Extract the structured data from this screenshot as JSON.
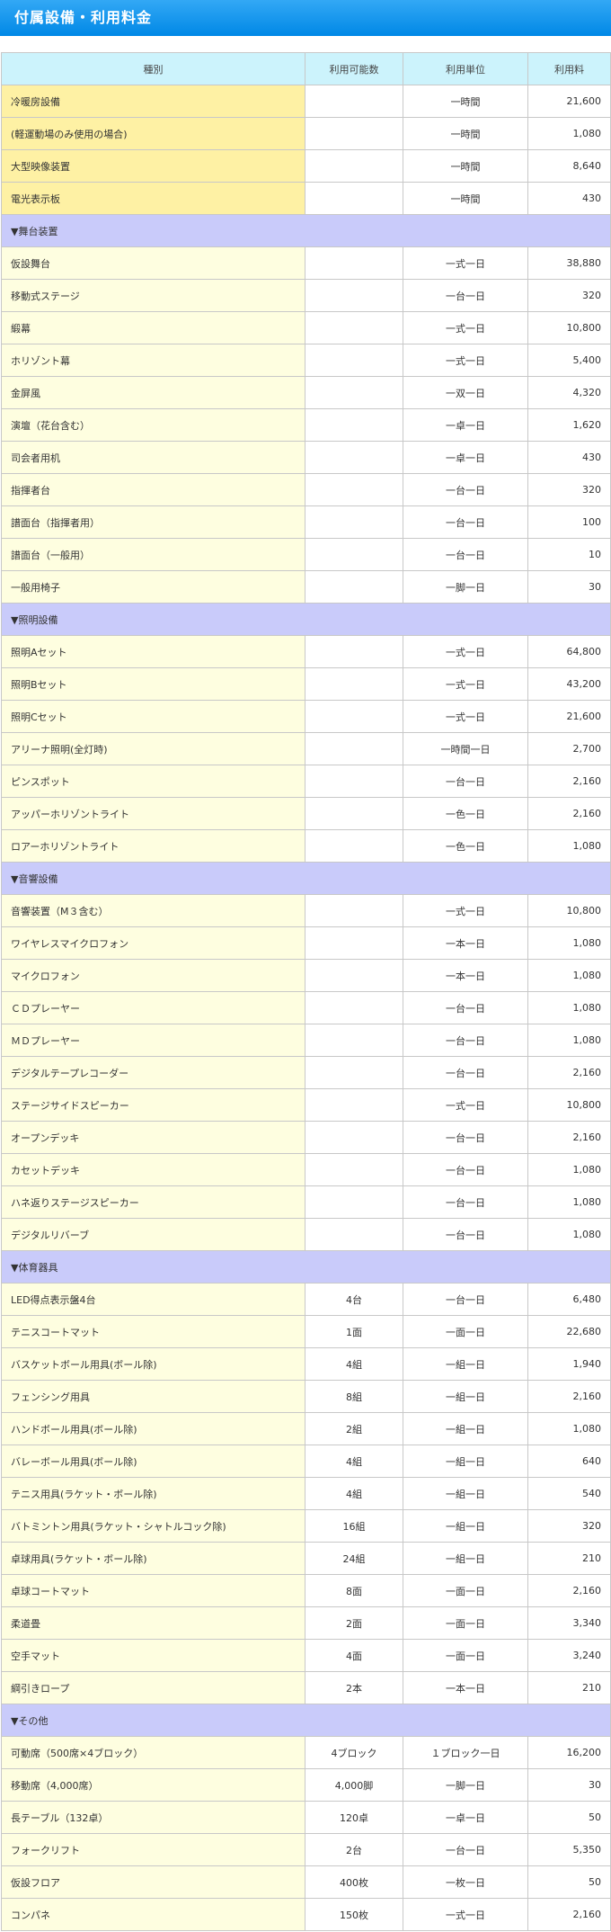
{
  "page": {
    "title": "付属設備・利用料金"
  },
  "table": {
    "headers": {
      "type": "種別",
      "count": "利用可能数",
      "unit": "利用単位",
      "fee": "利用料"
    },
    "rows": [
      {
        "kind": "item",
        "highlight": true,
        "name": "冷暖房設備",
        "count": "",
        "unit": "一時間",
        "fee": "21,600"
      },
      {
        "kind": "item",
        "highlight": true,
        "name": "(軽運動場のみ使用の場合)",
        "count": "",
        "unit": "一時間",
        "fee": "1,080"
      },
      {
        "kind": "item",
        "highlight": true,
        "name": "大型映像装置",
        "count": "",
        "unit": "一時間",
        "fee": "8,640"
      },
      {
        "kind": "item",
        "highlight": true,
        "name": "電光表示板",
        "count": "",
        "unit": "一時間",
        "fee": "430"
      },
      {
        "kind": "section",
        "name": "▼舞台装置"
      },
      {
        "kind": "item",
        "name": "仮設舞台",
        "count": "",
        "unit": "一式一日",
        "fee": "38,880"
      },
      {
        "kind": "item",
        "name": "移動式ステージ",
        "count": "",
        "unit": "一台一日",
        "fee": "320"
      },
      {
        "kind": "item",
        "name": "緞幕",
        "count": "",
        "unit": "一式一日",
        "fee": "10,800"
      },
      {
        "kind": "item",
        "name": "ホリゾント幕",
        "count": "",
        "unit": "一式一日",
        "fee": "5,400"
      },
      {
        "kind": "item",
        "name": "金屏風",
        "count": "",
        "unit": "一双一日",
        "fee": "4,320"
      },
      {
        "kind": "item",
        "name": "演壇（花台含む）",
        "count": "",
        "unit": "一卓一日",
        "fee": "1,620"
      },
      {
        "kind": "item",
        "name": "司会者用机",
        "count": "",
        "unit": "一卓一日",
        "fee": "430"
      },
      {
        "kind": "item",
        "name": "指揮者台",
        "count": "",
        "unit": "一台一日",
        "fee": "320"
      },
      {
        "kind": "item",
        "name": "譜面台（指揮者用）",
        "count": "",
        "unit": "一台一日",
        "fee": "100"
      },
      {
        "kind": "item",
        "name": "譜面台（一般用）",
        "count": "",
        "unit": "一台一日",
        "fee": "10"
      },
      {
        "kind": "item",
        "name": "一般用椅子",
        "count": "",
        "unit": "一脚一日",
        "fee": "30"
      },
      {
        "kind": "section",
        "name": "▼照明設備"
      },
      {
        "kind": "item",
        "name": "照明Aセット",
        "count": "",
        "unit": "一式一日",
        "fee": "64,800"
      },
      {
        "kind": "item",
        "name": "照明Bセット",
        "count": "",
        "unit": "一式一日",
        "fee": "43,200"
      },
      {
        "kind": "item",
        "name": "照明Cセット",
        "count": "",
        "unit": "一式一日",
        "fee": "21,600"
      },
      {
        "kind": "item",
        "name": "アリーナ照明(全灯時)",
        "count": "",
        "unit": "一時間一日",
        "fee": "2,700"
      },
      {
        "kind": "item",
        "name": "ピンスポット",
        "count": "",
        "unit": "一台一日",
        "fee": "2,160"
      },
      {
        "kind": "item",
        "name": "アッパーホリゾントライト",
        "count": "",
        "unit": "一色一日",
        "fee": "2,160"
      },
      {
        "kind": "item",
        "name": "ロアーホリゾントライト",
        "count": "",
        "unit": "一色一日",
        "fee": "1,080"
      },
      {
        "kind": "section",
        "name": "▼音響設備"
      },
      {
        "kind": "item",
        "name": "音響装置（M３含む）",
        "count": "",
        "unit": "一式一日",
        "fee": "10,800"
      },
      {
        "kind": "item",
        "name": "ワイヤレスマイクロフォン",
        "count": "",
        "unit": "一本一日",
        "fee": "1,080"
      },
      {
        "kind": "item",
        "name": "マイクロフォン",
        "count": "",
        "unit": "一本一日",
        "fee": "1,080"
      },
      {
        "kind": "item",
        "name": "ＣＤプレーヤー",
        "count": "",
        "unit": "一台一日",
        "fee": "1,080"
      },
      {
        "kind": "item",
        "name": "ＭＤプレーヤー",
        "count": "",
        "unit": "一台一日",
        "fee": "1,080"
      },
      {
        "kind": "item",
        "name": "デジタルテープレコーダー",
        "count": "",
        "unit": "一台一日",
        "fee": "2,160"
      },
      {
        "kind": "item",
        "name": "ステージサイドスピーカー",
        "count": "",
        "unit": "一式一日",
        "fee": "10,800"
      },
      {
        "kind": "item",
        "name": "オープンデッキ",
        "count": "",
        "unit": "一台一日",
        "fee": "2,160"
      },
      {
        "kind": "item",
        "name": "カセットデッキ",
        "count": "",
        "unit": "一台一日",
        "fee": "1,080"
      },
      {
        "kind": "item",
        "name": "ハネ返りステージスピーカー",
        "count": "",
        "unit": "一台一日",
        "fee": "1,080"
      },
      {
        "kind": "item",
        "name": "デジタルリバーブ",
        "count": "",
        "unit": "一台一日",
        "fee": "1,080"
      },
      {
        "kind": "section",
        "name": "▼体育器具"
      },
      {
        "kind": "item",
        "name": "LED得点表示盤4台",
        "count": "4台",
        "unit": "一台一日",
        "fee": "6,480"
      },
      {
        "kind": "item",
        "name": "テニスコートマット",
        "count": "1面",
        "unit": "一面一日",
        "fee": "22,680"
      },
      {
        "kind": "item",
        "name": "バスケットボール用具(ボール除)",
        "count": "4組",
        "unit": "一組一日",
        "fee": "1,940"
      },
      {
        "kind": "item",
        "name": "フェンシング用具",
        "count": "8組",
        "unit": "一組一日",
        "fee": "2,160"
      },
      {
        "kind": "item",
        "name": "ハンドボール用具(ボール除)",
        "count": "2組",
        "unit": "一組一日",
        "fee": "1,080"
      },
      {
        "kind": "item",
        "name": "バレーボール用具(ボール除)",
        "count": "4組",
        "unit": "一組一日",
        "fee": "640"
      },
      {
        "kind": "item",
        "name": "テニス用具(ラケット・ボール除)",
        "count": "4組",
        "unit": "一組一日",
        "fee": "540"
      },
      {
        "kind": "item",
        "name": "バトミントン用具(ラケット・シャトルコック除)",
        "count": "16組",
        "unit": "一組一日",
        "fee": "320"
      },
      {
        "kind": "item",
        "name": "卓球用具(ラケット・ボール除)",
        "count": "24組",
        "unit": "一組一日",
        "fee": "210"
      },
      {
        "kind": "item",
        "name": "卓球コートマット",
        "count": "8面",
        "unit": "一面一日",
        "fee": "2,160"
      },
      {
        "kind": "item",
        "name": "柔道畳",
        "count": "2面",
        "unit": "一面一日",
        "fee": "3,340"
      },
      {
        "kind": "item",
        "name": "空手マット",
        "count": "4面",
        "unit": "一面一日",
        "fee": "3,240"
      },
      {
        "kind": "item",
        "name": "綱引きロープ",
        "count": "2本",
        "unit": "一本一日",
        "fee": "210"
      },
      {
        "kind": "section",
        "name": "▼その他"
      },
      {
        "kind": "item",
        "name": "可動席（500席×4ブロック）",
        "count": "4ブロック",
        "unit": "１ブロック一日",
        "fee": "16,200"
      },
      {
        "kind": "item",
        "name": "移動席（4,000席）",
        "count": "4,000脚",
        "unit": "一脚一日",
        "fee": "30"
      },
      {
        "kind": "item",
        "name": "長テーブル（132卓）",
        "count": "120卓",
        "unit": "一卓一日",
        "fee": "50"
      },
      {
        "kind": "item",
        "name": "フォークリフト",
        "count": "2台",
        "unit": "一台一日",
        "fee": "5,350"
      },
      {
        "kind": "item",
        "name": "仮設フロア",
        "count": "400枚",
        "unit": "一枚一日",
        "fee": "50"
      },
      {
        "kind": "item",
        "name": "コンパネ",
        "count": "150枚",
        "unit": "一式一日",
        "fee": "2,160"
      }
    ]
  }
}
